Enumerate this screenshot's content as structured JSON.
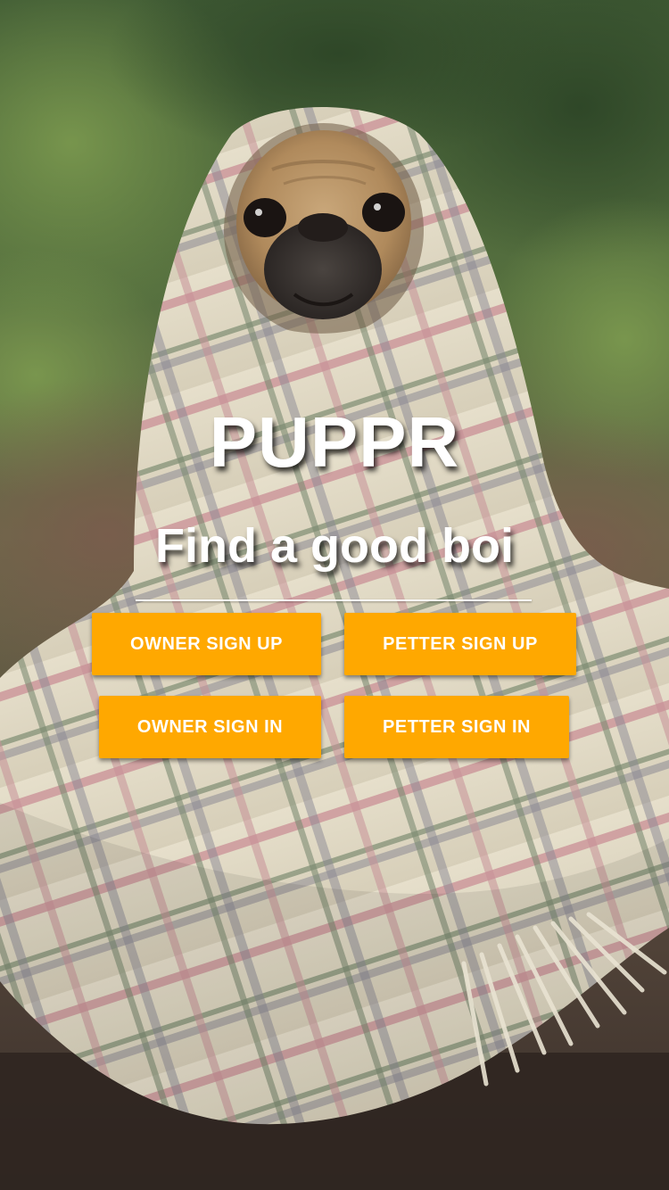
{
  "app": {
    "title": "PUPPR",
    "tagline": "Find a good boi"
  },
  "buttons": {
    "owner_sign_up": "OWNER SIGN UP",
    "petter_sign_up": "PETTER SIGN UP",
    "owner_sign_in": "OWNER SIGN IN",
    "petter_sign_in": "PETTER SIGN IN"
  },
  "colors": {
    "button_background": "#ffa800",
    "button_text": "#ffffff",
    "heading_text": "#ffffff"
  },
  "background": {
    "subject": "pug-wrapped-in-plaid-blanket-photo"
  }
}
